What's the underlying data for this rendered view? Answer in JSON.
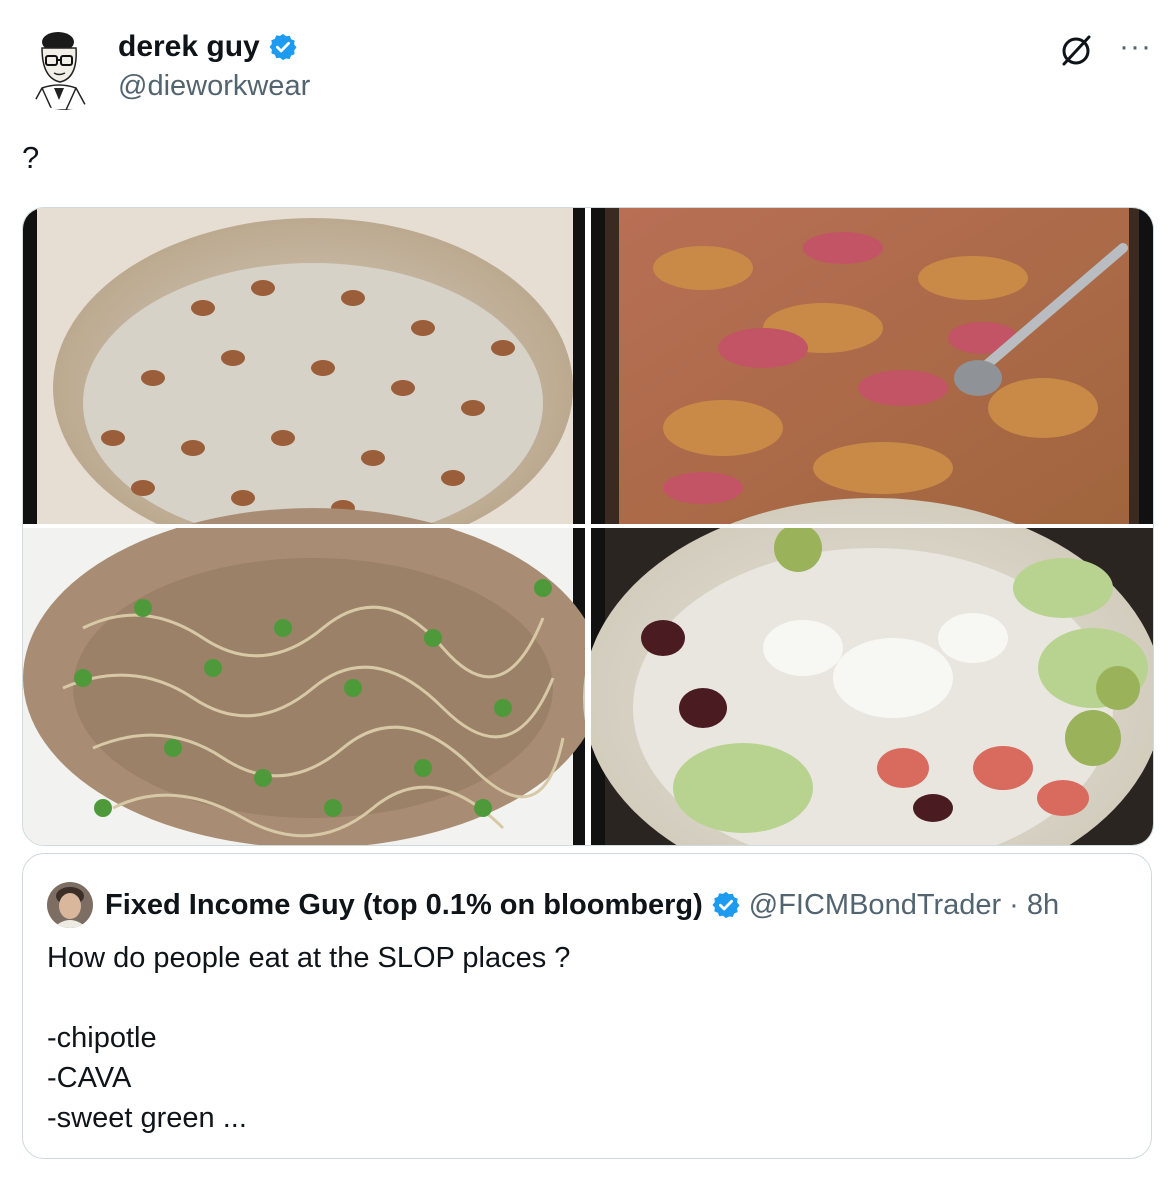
{
  "tweet": {
    "author_name": "derek guy",
    "author_handle": "@dieworkwear",
    "text": "?",
    "icons": {
      "verified": "verified-badge-icon",
      "grok": "grok-icon",
      "more": "more-options-icon"
    },
    "more_label": "···"
  },
  "quoted_tweet": {
    "author_name": "Fixed Income Guy (top 0.1% on bloomberg)",
    "author_handle": "@FICMBondTrader",
    "separator": "·",
    "timestamp": "8h",
    "lines": [
      "How do people eat at the SLOP places ?",
      "",
      "-chipotle",
      "-CAVA",
      "-sweet green ..."
    ]
  },
  "colors": {
    "verified": "#1d9bf0",
    "secondary_text": "#536471",
    "border": "#cfd9de"
  }
}
